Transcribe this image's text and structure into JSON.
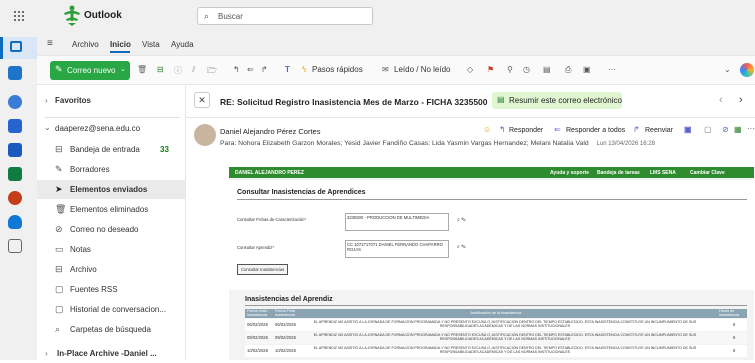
{
  "app": {
    "name": "Outlook",
    "search_placeholder": "Buscar"
  },
  "menu": [
    "Archivo",
    "Inicio",
    "Vista",
    "Ayuda"
  ],
  "ribbon": {
    "new_mail": "Correo nuevo",
    "quick_steps": "Pasos rápidos",
    "read_unread": "Leído / No leído"
  },
  "sidebar": {
    "favorites": "Favoritos",
    "account": "daaperez@sena.edu.co",
    "folders": [
      {
        "label": "Bandeja de entrada",
        "count": "33",
        "icon": "inbox-icon"
      },
      {
        "label": "Borradores",
        "count": "",
        "icon": "draft-icon"
      },
      {
        "label": "Elementos enviados",
        "count": "",
        "icon": "send-icon"
      },
      {
        "label": "Elementos eliminados",
        "count": "",
        "icon": "trash-icon"
      },
      {
        "label": "Correo no deseado",
        "count": "",
        "icon": "junk-icon"
      },
      {
        "label": "Notas",
        "count": "",
        "icon": "notes-icon"
      },
      {
        "label": "Archivo",
        "count": "",
        "icon": "archive-icon"
      },
      {
        "label": "Fuentes RSS",
        "count": "",
        "icon": "rss-icon"
      },
      {
        "label": "Historial de conversacion...",
        "count": "",
        "icon": "history-icon"
      },
      {
        "label": "Carpetas de búsqueda",
        "count": "",
        "icon": "search-folder-icon"
      }
    ],
    "archive": "In-Place Archive -Daniel ..."
  },
  "message": {
    "subject": "RE: Solicitud Registro Inasistencia Mes de Marzo - FICHA 3235500",
    "summarize": "Resumir este correo electrónico",
    "sender": "Daniel Alejandro Pérez Cortes",
    "reply": "Responder",
    "reply_all": "Responder a todos",
    "forward": "Reenviar",
    "to_label": "Para:",
    "recipients": "Nohora Elizabeth Garzon Morales; Yesid Javier Fandiño Casas; Lida Yasmin Vargas Hernandez; Melani Natalia Vald",
    "date": "Lun 13/04/2026 16:28"
  },
  "embedded": {
    "user": "DANIEL ALEJANDRO PEREZ",
    "nav": [
      "Ayuda y soporte",
      "Bandeja de tareas",
      "LMS SENA",
      "Cambiar Clave"
    ],
    "section1": "Consultar Inasistencias de Aprendices",
    "ficha_label": "Consultar Fichas de Caracterización*",
    "ficha_value": "3235500 - PRODUCCION DE MULTIMEDIA",
    "aprendiz_label": "Consultar Aprendiz*",
    "aprendiz_value": "CC 1072717071 DANIEL FERNANDO CHAPARRO ROJAS",
    "consult_btn": "Consultar Inasistencias",
    "section2": "Inasistencias del Aprendiz",
    "table_headers": [
      "Fecha Inicio Inasistencia",
      "Fecha Final Inasistencia",
      "Justificación de la Inasistencia",
      "Horas de Inasistencia"
    ],
    "rows": [
      {
        "start": "06/02/2026",
        "end": "06/02/2026",
        "text": "EL APRENDIZ NO ASISTIÓ A LA JORNADA DE FORMACIÓN PROGRAMADA Y NO PRESENTÓ EXCUSA O JUSTIFICACIÓN DENTRO DEL TIEMPO ESTABLECIDO. ESTA INASISTENCIA CONSTITUYE UN INCUMPLIMIENTO DE SUS RESPONSABILIDADES ACADÉMICAS Y DE LAS NORMAS INSTITUCIONALES",
        "hours": "6"
      },
      {
        "start": "09/02/2026",
        "end": "09/02/2026",
        "text": "EL APRENDIZ NO ASISTIÓ A LA JORNADA DE FORMACIÓN PROGRAMADA Y NO PRESENTÓ EXCUSA O JUSTIFICACIÓN DENTRO DEL TIEMPO ESTABLECIDO. ESTA INASISTENCIA CONSTITUYE UN INCUMPLIMIENTO DE SUS RESPONSABILIDADES ACADÉMICAS Y DE LAS NORMAS INSTITUCIONALES",
        "hours": "6"
      },
      {
        "start": "10/02/2026",
        "end": "10/02/2026",
        "text": "EL APRENDIZ NO ASISTIÓ A LA JORNADA DE FORMACIÓN PROGRAMADA Y NO PRESENTÓ EXCUSA O JUSTIFICACIÓN DENTRO DEL TIEMPO ESTABLECIDO. ESTA INASISTENCIA CONSTITUYE UN INCUMPLIMIENTO DE SUS RESPONSABILIDADES ACADÉMICAS Y DE LAS NORMAS INSTITUCIONALES",
        "hours": "6"
      }
    ]
  }
}
